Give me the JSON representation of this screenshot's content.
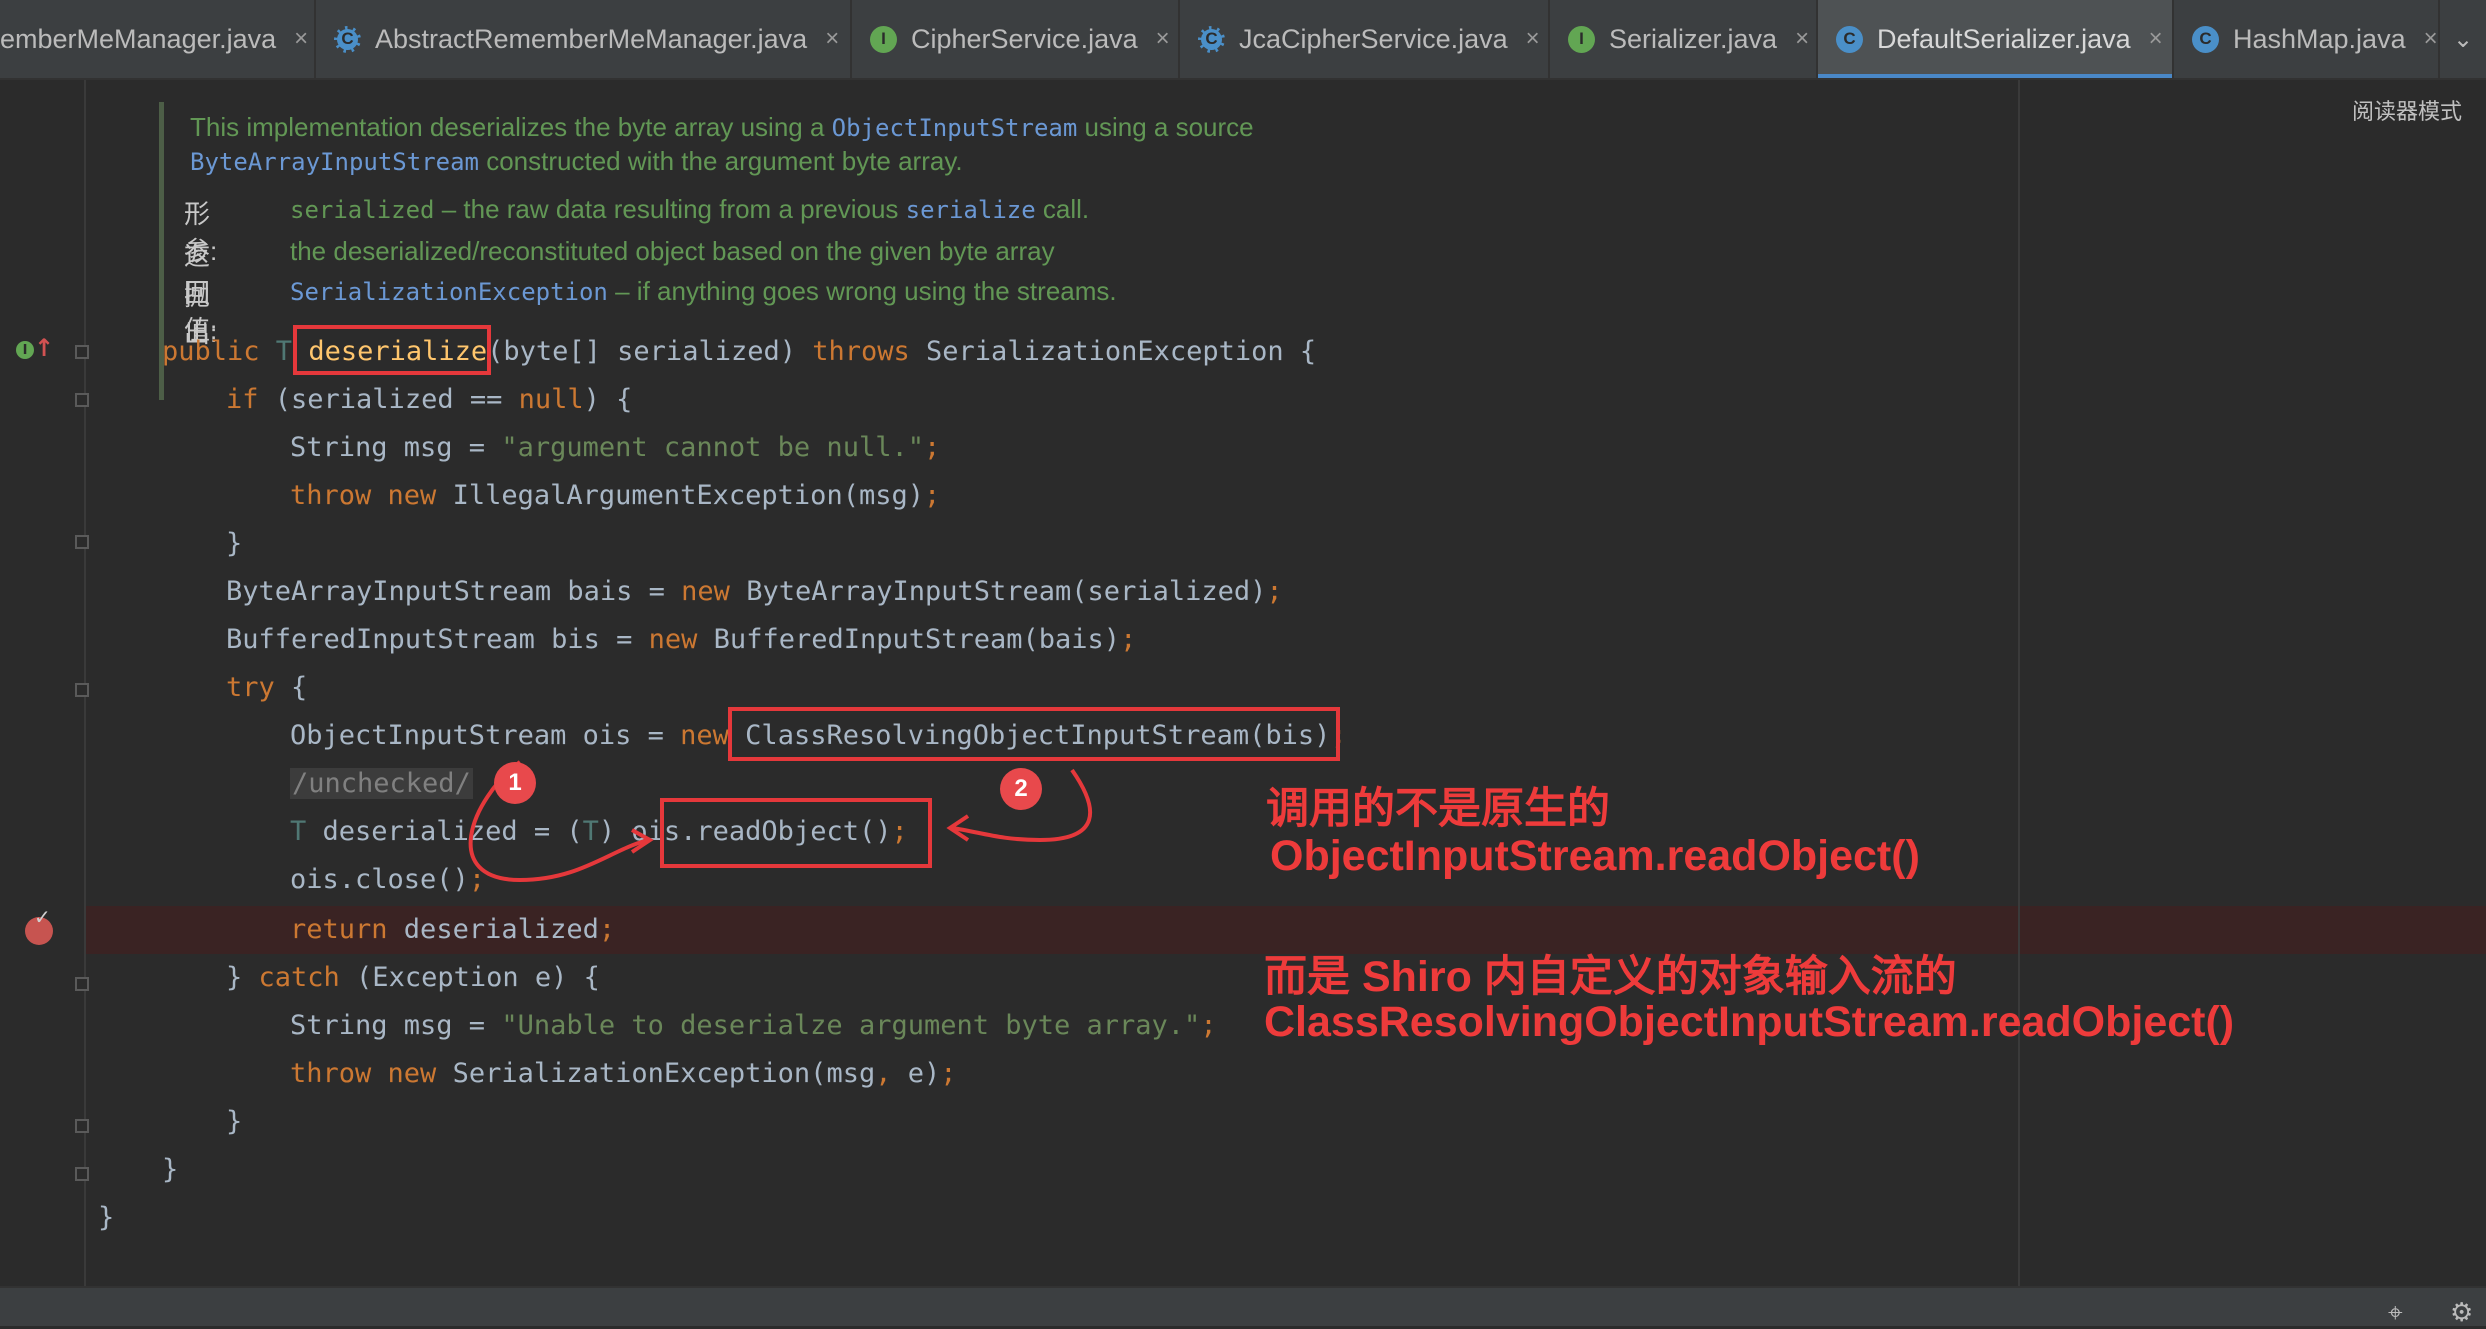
{
  "tabs": [
    {
      "label": "emberMeManager.java",
      "kind": "c",
      "active": false
    },
    {
      "label": "AbstractRememberMeManager.java",
      "kind": "ac",
      "active": false
    },
    {
      "label": "CipherService.java",
      "kind": "i",
      "active": false
    },
    {
      "label": "JcaCipherService.java",
      "kind": "ac",
      "active": false
    },
    {
      "label": "Serializer.java",
      "kind": "i",
      "active": false
    },
    {
      "label": "DefaultSerializer.java",
      "kind": "c",
      "active": true
    },
    {
      "label": "HashMap.java",
      "kind": "c",
      "active": false
    }
  ],
  "tab_icons": {
    "c": "C",
    "ac": "C",
    "i": "I"
  },
  "close_glyph": "×",
  "more_glyph": "⌄",
  "reader_mode": "阅读器模式",
  "javadoc": {
    "line1_a": "This implementation deserializes the byte array using a ",
    "line1_code": "ObjectInputStream",
    "line1_b": " using a source",
    "line2_code": "ByteArrayInputStream",
    "line2_b": " constructed with the argument byte array.",
    "params_label": "形参:",
    "params_code": "serialized",
    "params_a": " – the raw data resulting from a previous ",
    "params_code2": "serialize",
    "params_b": " call.",
    "returns_label": "返回值:",
    "returns_text": "the deserialized/reconstituted object based on the given byte array",
    "throws_label": "抛出:",
    "throws_code": "SerializationException",
    "throws_text": " – if anything goes wrong using the streams."
  },
  "code": {
    "l1_public": "public ",
    "l1_t": "T ",
    "l1_method": "deserialize",
    "l1_params": "(byte[] serialized) ",
    "l1_throws": "throws",
    "l1_rest": " SerializationException {",
    "l2_if": "if",
    "l2_a": " (serialized == ",
    "l2_null": "null",
    "l2_b": ") {",
    "l3_a": "String msg = ",
    "l3_str": "\"argument cannot be null.\"",
    "l3_semi": ";",
    "l4_throw": "throw",
    "l4_new": " new",
    "l4_rest": " IllegalArgumentException(msg)",
    "l4_semi": ";",
    "l5": "}",
    "l6_a": "ByteArrayInputStream bais = ",
    "l6_new": "new",
    "l6_b": " ByteArrayInputStream(serialized)",
    "l6_semi": ";",
    "l7_a": "BufferedInputStream bis = ",
    "l7_new": "new",
    "l7_b": " BufferedInputStream(bais)",
    "l7_semi": ";",
    "l8_try": "try",
    "l8_b": " {",
    "l9_a": "ObjectInputStream ois = ",
    "l9_new": "new",
    "l9_b": " ClassResolvingObjectInputStream(bis)",
    "l9_semi": ";",
    "l10_comment": "/unchecked/",
    "l11_t": "T",
    "l11_a": " deserialized = (",
    "l11_t2": "T",
    "l11_b": ") ois.readObject()",
    "l11_semi": ";",
    "l12_a": "ois.close()",
    "l12_semi": ";",
    "l13_return": "return",
    "l13_b": " deserialized",
    "l13_semi": ";",
    "l14_a": "} ",
    "l14_catch": "catch",
    "l14_b": " (Exception e) {",
    "l15_a": "String msg = ",
    "l15_str": "\"Unable to deserialze argument byte array.\"",
    "l15_semi": ";",
    "l16_throw": "throw",
    "l16_new": " new",
    "l16_rest": " SerializationException(msg",
    "l16_comma": ",",
    "l16_end": " e)",
    "l16_semi": ";",
    "l17": "}",
    "l18": "}",
    "l19": "}"
  },
  "gutter": {
    "impl_icon": "I",
    "impl_arrow": "↑",
    "bp_check": "✓"
  },
  "annotations": {
    "badge1": "1",
    "badge2": "2",
    "note_line1": "调用的不是原生的",
    "note_line2": "ObjectInputStream.readObject()",
    "note_line3": "而是 Shiro 内自定义的对象输入流的",
    "note_line4": "ClassResolvingObjectInputStream.readObject()",
    "color": "#ee3b3b"
  },
  "statusbar": {
    "icon1": "⌖",
    "icon2": "⚙"
  }
}
